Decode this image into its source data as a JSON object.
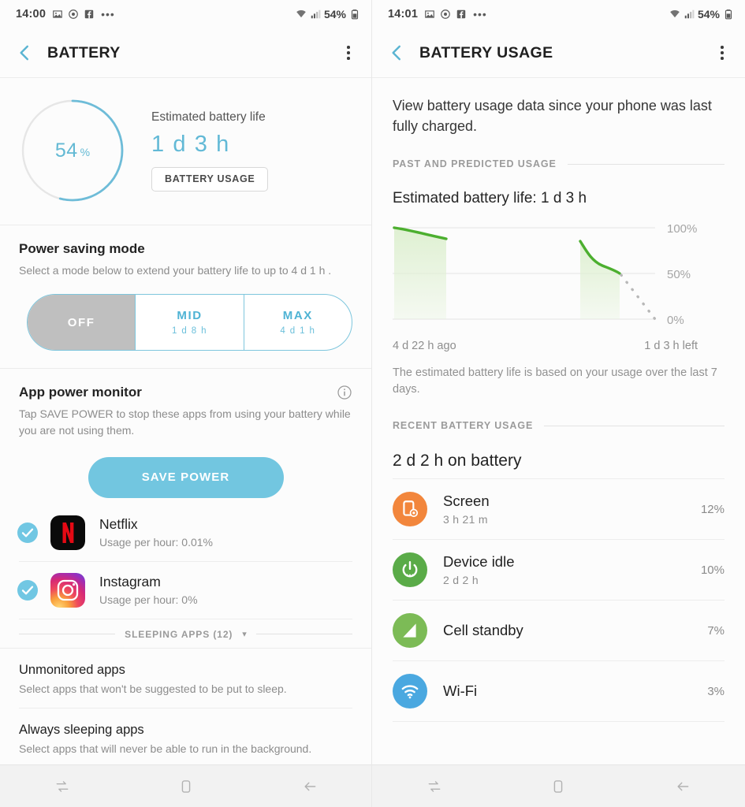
{
  "left": {
    "statusbar": {
      "time": "14:00",
      "icons": [
        "image-icon",
        "clock-icon",
        "facebook-icon",
        "more-icon"
      ],
      "wifi_icon": "wifi-icon",
      "signal_icon": "cellular-signal-icon",
      "battery_percent": "54%",
      "battery_icon": "battery-icon"
    },
    "appbar": {
      "back_icon": "back-chevron-icon",
      "title": "BATTERY",
      "menu_icon": "overflow-menu-icon"
    },
    "summary": {
      "ring_value": "54",
      "ring_unit": "%",
      "ring_percent": 54,
      "caption": "Estimated battery life",
      "estimate": "1 d 3 h",
      "usage_button": "BATTERY USAGE"
    },
    "power_saving": {
      "title": "Power saving mode",
      "subtitle": "Select a mode below to extend your battery life to up to 4 d 1 h .",
      "modes": [
        {
          "label": "OFF",
          "detail": "",
          "selected": true
        },
        {
          "label": "MID",
          "detail": "1 d 8 h",
          "selected": false
        },
        {
          "label": "MAX",
          "detail": "4 d 1 h",
          "selected": false
        }
      ]
    },
    "app_monitor": {
      "title": "App power monitor",
      "info_icon": "info-icon",
      "subtitle": "Tap SAVE POWER to stop these apps from using your battery while you are not using them.",
      "save_button": "SAVE POWER",
      "apps": [
        {
          "name": "Netflix",
          "usage": "Usage per hour: 0.01%",
          "checked": true,
          "icon": "netflix-icon"
        },
        {
          "name": "Instagram",
          "usage": "Usage per hour: 0%",
          "checked": true,
          "icon": "instagram-icon"
        }
      ],
      "sleeping_label": "SLEEPING APPS (12)",
      "sleeping_chevron": "chevron-down-icon"
    },
    "other_sections": [
      {
        "title": "Unmonitored apps",
        "subtitle": "Select apps that won't be suggested to be put to sleep."
      },
      {
        "title": "Always sleeping apps",
        "subtitle": "Select apps that will never be able to run in the background."
      }
    ]
  },
  "right": {
    "statusbar": {
      "time": "14:01",
      "battery_percent": "54%"
    },
    "appbar": {
      "back_icon": "back-chevron-icon",
      "title": "BATTERY USAGE",
      "menu_icon": "overflow-menu-icon"
    },
    "intro": "View battery usage data since your phone was last fully charged.",
    "section_past": "PAST AND PREDICTED USAGE",
    "estimate_line": "Estimated battery life: 1 d 3 h",
    "note": "The estimated battery life is based on your usage over the last 7 days.",
    "section_recent": "RECENT BATTERY USAGE",
    "total_on_battery": "2 d 2 h on battery",
    "usage_items": [
      {
        "name": "Screen",
        "detail": "3 h 21 m",
        "percent": "12%",
        "icon": "screen-icon",
        "color": "#f2863c"
      },
      {
        "name": "Device idle",
        "detail": "2 d 2 h",
        "percent": "10%",
        "icon": "power-idle-icon",
        "color": "#5aab48"
      },
      {
        "name": "Cell standby",
        "detail": "",
        "percent": "7%",
        "icon": "cell-signal-icon",
        "color": "#7cbb56"
      },
      {
        "name": "Wi-Fi",
        "detail": "",
        "percent": "3%",
        "icon": "wifi-icon",
        "color": "#4aa8e0"
      }
    ]
  },
  "chart_data": {
    "type": "area",
    "title": "Estimated battery life: 1 d 3 h",
    "xlabel": "",
    "ylabel": "",
    "ylim": [
      0,
      100
    ],
    "yticks": [
      0,
      50,
      100
    ],
    "ytick_labels": [
      "0%",
      "50%",
      "100%"
    ],
    "x_start_label": "4 d 22 h ago",
    "x_end_label": "1 d 3 h left",
    "grid": true,
    "legend": false,
    "line_color": "#4caf2f",
    "fill_color": "#e3f3d8",
    "prediction_color": "#b3b3b3",
    "series": [
      {
        "name": "Past usage segment 1",
        "style": "solid-area",
        "points": [
          [
            0,
            100
          ],
          [
            6,
            96
          ],
          [
            12,
            93
          ],
          [
            18,
            90
          ],
          [
            22,
            88
          ]
        ]
      },
      {
        "name": "Past usage segment 2",
        "style": "solid-area",
        "points": [
          [
            76,
            85
          ],
          [
            80,
            76
          ],
          [
            84,
            68
          ],
          [
            88,
            63
          ],
          [
            92,
            60
          ],
          [
            95,
            55
          ],
          [
            97,
            52
          ]
        ]
      },
      {
        "name": "Predicted usage",
        "style": "dotted-line",
        "points": [
          [
            97,
            52
          ],
          [
            100,
            38
          ],
          [
            103,
            24
          ],
          [
            106,
            10
          ],
          [
            108,
            0
          ]
        ]
      }
    ]
  },
  "navbar": {
    "buttons": [
      {
        "name": "recents-button",
        "icon": "recents-icon"
      },
      {
        "name": "home-button",
        "icon": "home-icon"
      },
      {
        "name": "back-button",
        "icon": "back-arrow-icon"
      }
    ]
  }
}
